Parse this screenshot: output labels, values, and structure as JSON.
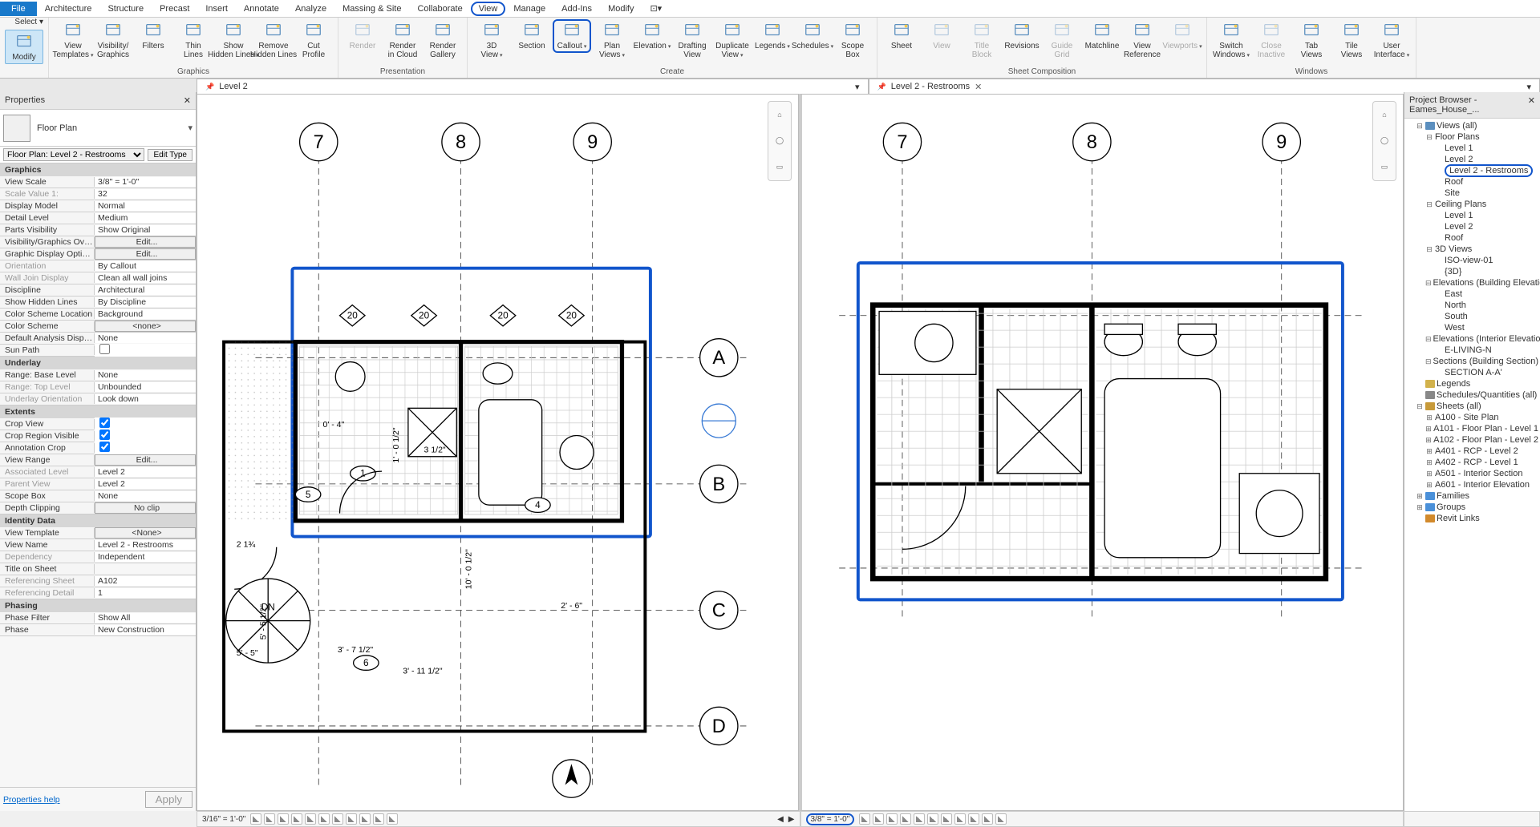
{
  "menu": [
    "File",
    "Architecture",
    "Structure",
    "Precast",
    "Insert",
    "Annotate",
    "Analyze",
    "Massing & Site",
    "Collaborate",
    "View",
    "Manage",
    "Add-Ins",
    "Modify"
  ],
  "menu_highlighted": "View",
  "ribbon": {
    "groups": [
      {
        "label": "",
        "items": [
          {
            "name": "modify",
            "label": "Modify",
            "big": true,
            "active": true,
            "disabled": false
          },
          {
            "name": "select-dd",
            "label": "Select ▾",
            "label_only": true
          }
        ]
      },
      {
        "label": "Graphics",
        "items": [
          {
            "name": "view-templates",
            "label": "View\nTemplates",
            "dd": true
          },
          {
            "name": "visibility-graphics",
            "label": "Visibility/\nGraphics"
          },
          {
            "name": "filters",
            "label": "Filters"
          },
          {
            "name": "thin-lines",
            "label": "Thin\nLines"
          },
          {
            "name": "show-hidden-lines",
            "label": "Show\nHidden Lines",
            "dd": true
          },
          {
            "name": "remove-hidden-lines",
            "label": "Remove\nHidden Lines"
          },
          {
            "name": "cut-profile",
            "label": "Cut\nProfile"
          }
        ]
      },
      {
        "label": "Presentation",
        "items": [
          {
            "name": "render",
            "label": "Render",
            "disabled": true
          },
          {
            "name": "render-in-cloud",
            "label": "Render\nin Cloud"
          },
          {
            "name": "render-gallery",
            "label": "Render\nGallery"
          }
        ]
      },
      {
        "label": "Create",
        "items": [
          {
            "name": "3d-view",
            "label": "3D\nView",
            "dd": true
          },
          {
            "name": "section",
            "label": "Section"
          },
          {
            "name": "callout",
            "label": "Callout",
            "dd": true,
            "hl": true
          },
          {
            "name": "plan-views",
            "label": "Plan\nViews",
            "dd": true
          },
          {
            "name": "elevation",
            "label": "Elevation",
            "dd": true
          },
          {
            "name": "drafting-view",
            "label": "Drafting\nView"
          },
          {
            "name": "duplicate-view",
            "label": "Duplicate\nView",
            "dd": true
          },
          {
            "name": "legends",
            "label": "Legends",
            "dd": true
          },
          {
            "name": "schedules",
            "label": "Schedules",
            "dd": true
          },
          {
            "name": "scope-box",
            "label": "Scope\nBox"
          }
        ]
      },
      {
        "label": "Sheet Composition",
        "items": [
          {
            "name": "sheet",
            "label": "Sheet"
          },
          {
            "name": "view",
            "label": "View",
            "disabled": true
          },
          {
            "name": "title-block",
            "label": "Title\nBlock",
            "disabled": true
          },
          {
            "name": "revisions",
            "label": "Revisions"
          },
          {
            "name": "guide-grid",
            "label": "Guide\nGrid",
            "disabled": true
          },
          {
            "name": "matchline",
            "label": "Matchline"
          },
          {
            "name": "view-reference",
            "label": "View\nReference"
          },
          {
            "name": "viewports",
            "label": "Viewports",
            "dd": true,
            "disabled": true
          }
        ]
      },
      {
        "label": "Windows",
        "items": [
          {
            "name": "switch-windows",
            "label": "Switch\nWindows",
            "dd": true
          },
          {
            "name": "close-inactive",
            "label": "Close\nInactive",
            "disabled": true
          },
          {
            "name": "tab-views",
            "label": "Tab\nViews"
          },
          {
            "name": "tile-views",
            "label": "Tile\nViews"
          },
          {
            "name": "user-interface",
            "label": "User\nInterface",
            "dd": true
          }
        ]
      }
    ]
  },
  "docs": [
    {
      "title": "Level 2",
      "pinned": true
    },
    {
      "title": "Level 2 - Restrooms",
      "closable": true
    }
  ],
  "properties": {
    "title": "Properties",
    "type_label": "Floor Plan",
    "instance": "Floor Plan: Level 2 - Restrooms",
    "edit_type": "Edit Type",
    "help": "Properties help",
    "apply": "Apply",
    "groups": [
      {
        "name": "Graphics",
        "rows": [
          {
            "k": "View Scale",
            "v": "3/8\" = 1'-0\""
          },
          {
            "k": "Scale Value   1:",
            "v": "32",
            "dim": true
          },
          {
            "k": "Display Model",
            "v": "Normal"
          },
          {
            "k": "Detail Level",
            "v": "Medium"
          },
          {
            "k": "Parts Visibility",
            "v": "Show Original"
          },
          {
            "k": "Visibility/Graphics Overr...",
            "v": "Edit...",
            "btn": true
          },
          {
            "k": "Graphic Display Options",
            "v": "Edit...",
            "btn": true
          },
          {
            "k": "Orientation",
            "v": "By Callout",
            "dim": true
          },
          {
            "k": "Wall Join Display",
            "v": "Clean all wall joins",
            "dim": true
          },
          {
            "k": "Discipline",
            "v": "Architectural"
          },
          {
            "k": "Show Hidden Lines",
            "v": "By Discipline"
          },
          {
            "k": "Color Scheme Location",
            "v": "Background"
          },
          {
            "k": "Color Scheme",
            "v": "<none>",
            "btn": true
          },
          {
            "k": "Default Analysis Display ...",
            "v": "None"
          },
          {
            "k": "Sun Path",
            "v": "",
            "chk": false
          }
        ]
      },
      {
        "name": "Underlay",
        "rows": [
          {
            "k": "Range: Base Level",
            "v": "None"
          },
          {
            "k": "Range: Top Level",
            "v": "Unbounded",
            "dim": true
          },
          {
            "k": "Underlay Orientation",
            "v": "Look down",
            "dim": true
          }
        ]
      },
      {
        "name": "Extents",
        "rows": [
          {
            "k": "Crop View",
            "v": "",
            "chk": true
          },
          {
            "k": "Crop Region Visible",
            "v": "",
            "chk": true
          },
          {
            "k": "Annotation Crop",
            "v": "",
            "chk": true
          },
          {
            "k": "View Range",
            "v": "Edit...",
            "btn": true
          },
          {
            "k": "Associated Level",
            "v": "Level 2",
            "dim": true
          },
          {
            "k": "Parent View",
            "v": "Level 2",
            "dim": true
          },
          {
            "k": "Scope Box",
            "v": "None"
          },
          {
            "k": "Depth Clipping",
            "v": "No clip",
            "btn": true
          }
        ]
      },
      {
        "name": "Identity Data",
        "rows": [
          {
            "k": "View Template",
            "v": "<None>",
            "btn": true
          },
          {
            "k": "View Name",
            "v": "Level 2 - Restrooms"
          },
          {
            "k": "Dependency",
            "v": "Independent",
            "dim": true
          },
          {
            "k": "Title on Sheet",
            "v": ""
          },
          {
            "k": "Referencing Sheet",
            "v": "A102",
            "dim": true
          },
          {
            "k": "Referencing Detail",
            "v": "1",
            "dim": true
          }
        ]
      },
      {
        "name": "Phasing",
        "rows": [
          {
            "k": "Phase Filter",
            "v": "Show All"
          },
          {
            "k": "Phase",
            "v": "New Construction"
          }
        ]
      }
    ]
  },
  "browser": {
    "title": "Project Browser - Eames_House_...",
    "tree": [
      {
        "l": "Views (all)",
        "d": 0,
        "t": "-",
        "ico": "views"
      },
      {
        "l": "Floor Plans",
        "d": 1,
        "t": "-"
      },
      {
        "l": "Level 1",
        "d": 2
      },
      {
        "l": "Level 2",
        "d": 2
      },
      {
        "l": "Level 2 - Restrooms",
        "d": 2,
        "sel": true
      },
      {
        "l": "Roof",
        "d": 2
      },
      {
        "l": "Site",
        "d": 2
      },
      {
        "l": "Ceiling Plans",
        "d": 1,
        "t": "-"
      },
      {
        "l": "Level 1",
        "d": 2
      },
      {
        "l": "Level 2",
        "d": 2
      },
      {
        "l": "Roof",
        "d": 2
      },
      {
        "l": "3D Views",
        "d": 1,
        "t": "-"
      },
      {
        "l": "ISO-view-01",
        "d": 2
      },
      {
        "l": "{3D}",
        "d": 2
      },
      {
        "l": "Elevations (Building Elevation",
        "d": 1,
        "t": "-"
      },
      {
        "l": "East",
        "d": 2
      },
      {
        "l": "North",
        "d": 2
      },
      {
        "l": "South",
        "d": 2
      },
      {
        "l": "West",
        "d": 2
      },
      {
        "l": "Elevations (Interior Elevation)",
        "d": 1,
        "t": "-"
      },
      {
        "l": "E-LIVING-N",
        "d": 2
      },
      {
        "l": "Sections (Building Section)",
        "d": 1,
        "t": "-"
      },
      {
        "l": "SECTION A-A'",
        "d": 2
      },
      {
        "l": "Legends",
        "d": 0,
        "ico": "legend"
      },
      {
        "l": "Schedules/Quantities (all)",
        "d": 0,
        "ico": "sched"
      },
      {
        "l": "Sheets (all)",
        "d": 0,
        "t": "-",
        "ico": "sheet"
      },
      {
        "l": "A100 - Site Plan",
        "d": 1,
        "t": "+"
      },
      {
        "l": "A101 - Floor Plan - Level 1",
        "d": 1,
        "t": "+"
      },
      {
        "l": "A102 - Floor Plan - Level 2",
        "d": 1,
        "t": "+"
      },
      {
        "l": "A401 - RCP - Level 2",
        "d": 1,
        "t": "+"
      },
      {
        "l": "A402 - RCP - Level 1",
        "d": 1,
        "t": "+"
      },
      {
        "l": "A501 - Interior Section",
        "d": 1,
        "t": "+"
      },
      {
        "l": "A601 - Interior Elevation",
        "d": 1,
        "t": "+"
      },
      {
        "l": "Families",
        "d": 0,
        "t": "+",
        "ico": "fam"
      },
      {
        "l": "Groups",
        "d": 0,
        "t": "+",
        "ico": "grp"
      },
      {
        "l": "Revit Links",
        "d": 0,
        "ico": "link"
      }
    ]
  },
  "status": {
    "left_scale": "3/16\" = 1'-0\"",
    "right_scale": "3/8\" = 1'-0\""
  },
  "plan_left": {
    "grids_v": [
      "7",
      "8",
      "9"
    ],
    "grids_h": [
      "A",
      "B",
      "C",
      "D"
    ],
    "tags": [
      "20",
      "20",
      "20",
      "20"
    ],
    "dims": [
      "0' - 4\"",
      "3 1/2\"",
      "1' - 0 1/2\"",
      "2 1¾",
      "5' - 5\"",
      "5' - 5 1/2\"",
      "3' - 7 1/2\"",
      "3' - 11 1/2\"",
      "10' - 0 1/2\"",
      "2' - 6\""
    ],
    "door_tags": [
      "1",
      "4",
      "5",
      "6"
    ],
    "stair": "DN"
  },
  "plan_right": {
    "grids_v": [
      "7",
      "8",
      "9"
    ]
  }
}
